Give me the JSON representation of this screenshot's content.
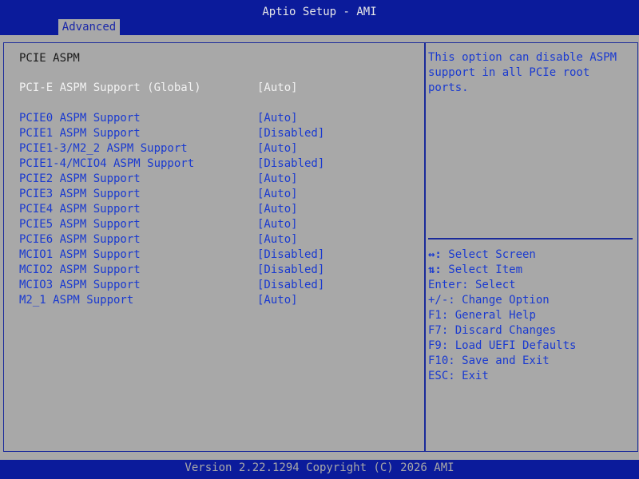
{
  "header": {
    "title": "Aptio Setup - AMI",
    "tabs": [
      {
        "label": "Advanced"
      }
    ]
  },
  "page": {
    "section_title": "PCIE ASPM",
    "global_option": {
      "label": "PCI-E ASPM Support (Global)",
      "value": "[Auto]"
    },
    "options": [
      {
        "label": "PCIE0 ASPM Support",
        "value": "[Auto]"
      },
      {
        "label": "PCIE1 ASPM Support",
        "value": "[Disabled]"
      },
      {
        "label": "PCIE1-3/M2_2 ASPM Support",
        "value": "[Auto]"
      },
      {
        "label": "PCIE1-4/MCIO4 ASPM Support",
        "value": "[Disabled]"
      },
      {
        "label": "PCIE2 ASPM Support",
        "value": "[Auto]"
      },
      {
        "label": "PCIE3 ASPM Support",
        "value": "[Auto]"
      },
      {
        "label": "PCIE4 ASPM Support",
        "value": "[Auto]"
      },
      {
        "label": "PCIE5 ASPM Support",
        "value": "[Auto]"
      },
      {
        "label": "PCIE6 ASPM Support",
        "value": "[Auto]"
      },
      {
        "label": "MCIO1 ASPM Support",
        "value": "[Disabled]"
      },
      {
        "label": "MCIO2 ASPM Support",
        "value": "[Disabled]"
      },
      {
        "label": "MCIO3 ASPM Support",
        "value": "[Disabled]"
      },
      {
        "label": "M2_1 ASPM Support",
        "value": "[Auto]"
      }
    ]
  },
  "help": {
    "lines": [
      "This option can disable ASPM",
      "support in all PCIe root ports."
    ]
  },
  "keys": [
    {
      "key": "↔:",
      "text": " Select Screen",
      "icon": "left-right-arrows"
    },
    {
      "key": "⇅:",
      "text": " Select Item",
      "icon": "up-down-arrows"
    },
    {
      "key": "Enter:",
      "text": " Select"
    },
    {
      "key": "+/-:",
      "text": " Change Option"
    },
    {
      "key": "F1:",
      "text": " General Help"
    },
    {
      "key": "F7:",
      "text": " Discard Changes"
    },
    {
      "key": "F9:",
      "text": " Load UEFI Defaults"
    },
    {
      "key": "F10:",
      "text": " Save and Exit"
    },
    {
      "key": "ESC:",
      "text": " Exit"
    }
  ],
  "footer": {
    "version": "Version 2.22.1294 Copyright (C) 2026 AMI"
  },
  "colors": {
    "header_bg": "#0b1b9b",
    "body_bg": "#a8a8a8",
    "option_text": "#1a3ad0",
    "selected_text": "#f2f2f2",
    "footer_text": "#a8a8a8"
  }
}
